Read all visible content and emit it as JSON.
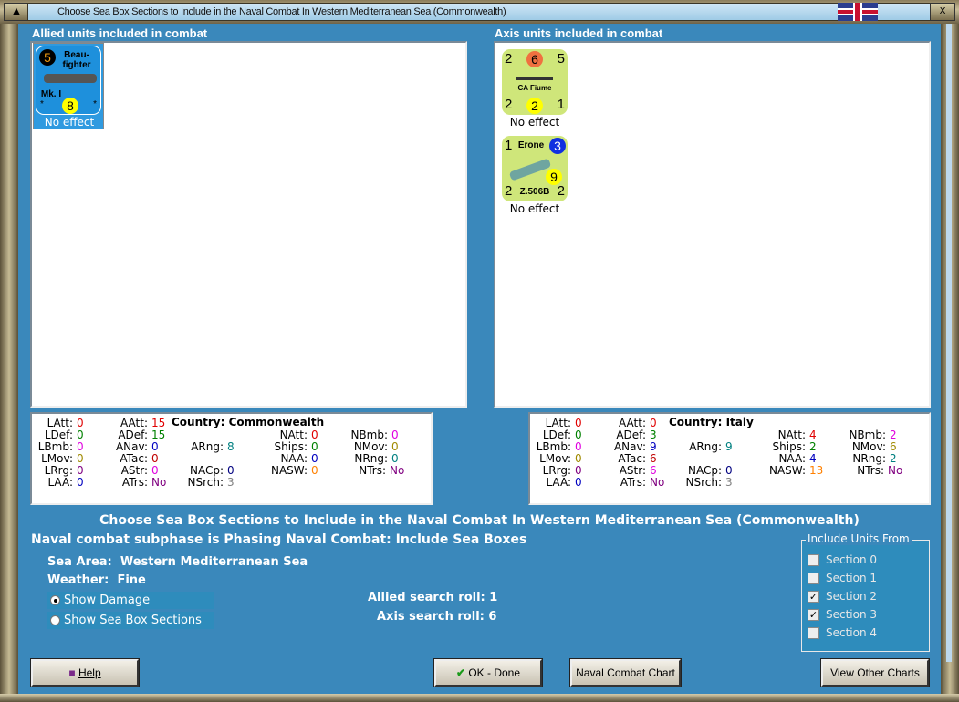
{
  "window": {
    "title": "Choose Sea Box Sections to Include in the Naval Combat In Western Mediterranean Sea (Commonwealth)",
    "minimize_icon": "▲",
    "close_icon": "X"
  },
  "allied": {
    "header": "Allied units included in combat",
    "units": [
      {
        "name": "Beau-fighter",
        "name_line1": "Beau-",
        "name_line2": "fighter",
        "variant": "Mk. I",
        "top_left": "5",
        "bottom": "8",
        "corner": "*",
        "status": "No effect"
      }
    ]
  },
  "axis": {
    "header": "Axis units included in combat",
    "units": [
      {
        "name": "CA Fiume",
        "tl": "2",
        "tc": "6",
        "tr": "5",
        "bl": "2",
        "bc": "2",
        "br": "1",
        "status": "No effect"
      },
      {
        "name": "Erone",
        "variant": "Z.506B",
        "tl": "1",
        "tr": "3",
        "mid": "9",
        "bl": "2",
        "br": "2",
        "status": "No effect"
      }
    ]
  },
  "allied_stats": {
    "country": "Country: Commonwealth",
    "items": [
      {
        "l": "LAtt:",
        "v": "0",
        "c": "#e00000"
      },
      {
        "l": "LDef:",
        "v": "0",
        "c": "#008000"
      },
      {
        "l": "LBmb:",
        "v": "0",
        "c": "#e000e0"
      },
      {
        "l": "LMov:",
        "v": "0",
        "c": "#a08a00"
      },
      {
        "l": "LRrg:",
        "v": "0",
        "c": "#800080"
      },
      {
        "l": "LAA:",
        "v": "0",
        "c": "#0000c0"
      },
      {
        "l": "AAtt:",
        "v": "15",
        "c": "#e00000"
      },
      {
        "l": "ADef:",
        "v": "15",
        "c": "#008000"
      },
      {
        "l": "ANav:",
        "v": "0",
        "c": "#0000c0"
      },
      {
        "l": "ATac:",
        "v": "0",
        "c": "#c00000"
      },
      {
        "l": "AStr:",
        "v": "0",
        "c": "#e000e0"
      },
      {
        "l": "ATrs:",
        "v": "No",
        "c": "#800080"
      },
      {
        "l": "ARng:",
        "v": "8",
        "c": "#008080"
      },
      {
        "l": "NACp:",
        "v": "0",
        "c": "#000080"
      },
      {
        "l": "NSrch:",
        "v": "3",
        "c": "#808080"
      },
      {
        "l": "NAtt:",
        "v": "0",
        "c": "#e00000"
      },
      {
        "l": "Ships:",
        "v": "0",
        "c": "#008000"
      },
      {
        "l": "NAA:",
        "v": "0",
        "c": "#0000c0"
      },
      {
        "l": "NASW:",
        "v": "0",
        "c": "#ff8000"
      },
      {
        "l": "NBmb:",
        "v": "0",
        "c": "#e000e0"
      },
      {
        "l": "NMov:",
        "v": "0",
        "c": "#a08a00"
      },
      {
        "l": "NRng:",
        "v": "0",
        "c": "#008080"
      },
      {
        "l": "NTrs:",
        "v": "No",
        "c": "#800080"
      }
    ]
  },
  "axis_stats": {
    "country": "Country: Italy",
    "items": [
      {
        "l": "LAtt:",
        "v": "0",
        "c": "#e00000"
      },
      {
        "l": "LDef:",
        "v": "0",
        "c": "#008000"
      },
      {
        "l": "LBmb:",
        "v": "0",
        "c": "#e000e0"
      },
      {
        "l": "LMov:",
        "v": "0",
        "c": "#a08a00"
      },
      {
        "l": "LRrg:",
        "v": "0",
        "c": "#800080"
      },
      {
        "l": "LAA:",
        "v": "0",
        "c": "#0000c0"
      },
      {
        "l": "AAtt:",
        "v": "0",
        "c": "#e00000"
      },
      {
        "l": "ADef:",
        "v": "3",
        "c": "#008000"
      },
      {
        "l": "ANav:",
        "v": "9",
        "c": "#0000c0"
      },
      {
        "l": "ATac:",
        "v": "6",
        "c": "#c00000"
      },
      {
        "l": "AStr:",
        "v": "6",
        "c": "#e000e0"
      },
      {
        "l": "ATrs:",
        "v": "No",
        "c": "#800080"
      },
      {
        "l": "ARng:",
        "v": "9",
        "c": "#008080"
      },
      {
        "l": "NACp:",
        "v": "0",
        "c": "#000080"
      },
      {
        "l": "NSrch:",
        "v": "3",
        "c": "#808080"
      },
      {
        "l": "NAtt:",
        "v": "4",
        "c": "#e00000"
      },
      {
        "l": "Ships:",
        "v": "2",
        "c": "#008000"
      },
      {
        "l": "NAA:",
        "v": "4",
        "c": "#0000c0"
      },
      {
        "l": "NASW:",
        "v": "13",
        "c": "#ff8000"
      },
      {
        "l": "NBmb:",
        "v": "2",
        "c": "#e000e0"
      },
      {
        "l": "NMov:",
        "v": "6",
        "c": "#a08a00"
      },
      {
        "l": "NRng:",
        "v": "2",
        "c": "#008080"
      },
      {
        "l": "NTrs:",
        "v": "No",
        "c": "#800080"
      }
    ]
  },
  "main": {
    "heading": "Choose Sea Box Sections to Include in the Naval Combat In Western Mediterranean Sea (Commonwealth)",
    "subphase": "Naval combat subphase is Phasing Naval Combat: Include Sea Boxes",
    "sea_area_label": "Sea Area:",
    "sea_area": "Western Mediterranean Sea",
    "weather_label": "Weather:",
    "weather": "Fine",
    "show_damage": "Show Damage",
    "show_sections": "Show Sea Box Sections",
    "allied_roll": "Allied search roll: 1",
    "axis_roll": "Axis search roll: 6"
  },
  "include": {
    "legend": "Include Units From",
    "sections": [
      {
        "label": "Section 0",
        "checked": false
      },
      {
        "label": "Section 1",
        "checked": false
      },
      {
        "label": "Section 2",
        "checked": true
      },
      {
        "label": "Section 3",
        "checked": true
      },
      {
        "label": "Section 4",
        "checked": false
      }
    ]
  },
  "buttons": {
    "help": "Help",
    "ok": "OK - Done",
    "chart": "Naval Combat Chart",
    "other": "View Other Charts"
  }
}
